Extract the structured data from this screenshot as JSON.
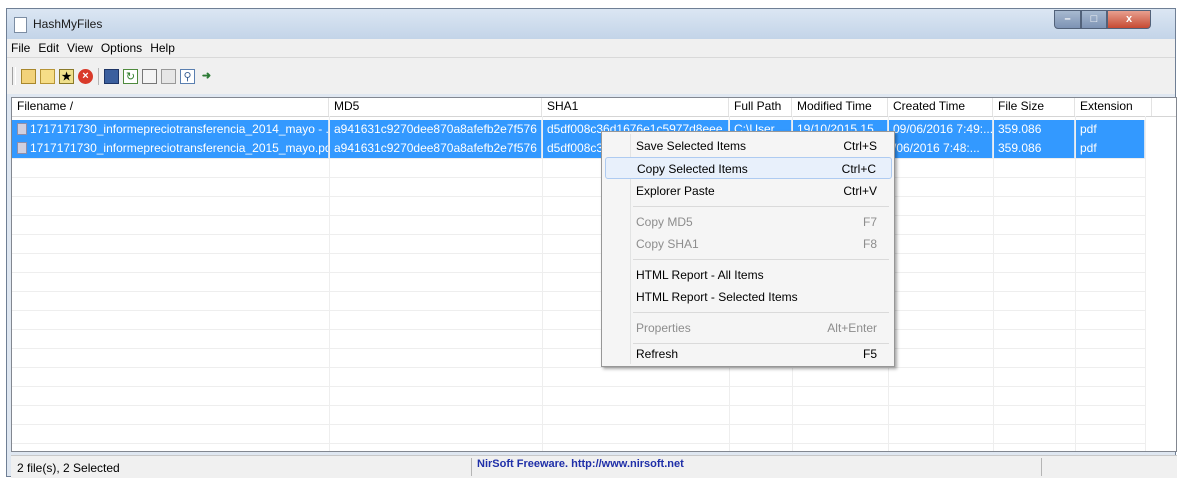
{
  "window": {
    "title": "HashMyFiles"
  },
  "controls": {
    "minimize": "–",
    "maximize": "□",
    "close": "x"
  },
  "menu": [
    "File",
    "Edit",
    "View",
    "Options",
    "Help"
  ],
  "toolbar_icons": [
    "open-folder-icon",
    "folder-icon",
    "add-files-icon",
    "stop-icon",
    "save-icon",
    "refresh-icon",
    "copy-icon",
    "properties-icon",
    "find-icon",
    "exit-icon"
  ],
  "columns": [
    "Filename /",
    "MD5",
    "SHA1",
    "Full Path",
    "Modified Time",
    "Created Time",
    "File Size",
    "Extension"
  ],
  "rows": [
    [
      "1717171730_informepreciotransferencia_2014_mayo - ...",
      "a941631c9270dee870a8afefb2e7f576",
      "d5df008c36d1676e1c5977d8eee...",
      "C:\\User...",
      "19/10/2015 15...",
      "09/06/2016 7:49:...",
      "359.086",
      "pdf"
    ],
    [
      "1717171730_informepreciotransferencia_2015_mayo.pdf",
      "a941631c9270dee870a8afefb2e7f576",
      "d5df008c36",
      "",
      "",
      "/06/2016 7:48:...",
      "359.086",
      "pdf"
    ]
  ],
  "context_menu": {
    "items": [
      {
        "label": "Save Selected Items",
        "shortcut": "Ctrl+S"
      },
      {
        "label": "Copy Selected Items",
        "shortcut": "Ctrl+C"
      },
      {
        "label": "Explorer Paste",
        "shortcut": "Ctrl+V"
      },
      {
        "label": "Copy MD5",
        "shortcut": "F7"
      },
      {
        "label": "Copy SHA1",
        "shortcut": "F8"
      },
      {
        "label": "HTML Report - All Items",
        "shortcut": ""
      },
      {
        "label": "HTML Report - Selected Items",
        "shortcut": ""
      },
      {
        "label": "Properties",
        "shortcut": "Alt+Enter"
      },
      {
        "label": "Refresh",
        "shortcut": "F5"
      }
    ]
  },
  "status": {
    "left": "2 file(s), 2 Selected",
    "center": "NirSoft Freeware.  http://www.nirsoft.net"
  },
  "colors": {
    "selection": "#3399ff",
    "link": "#1f2fa8"
  }
}
